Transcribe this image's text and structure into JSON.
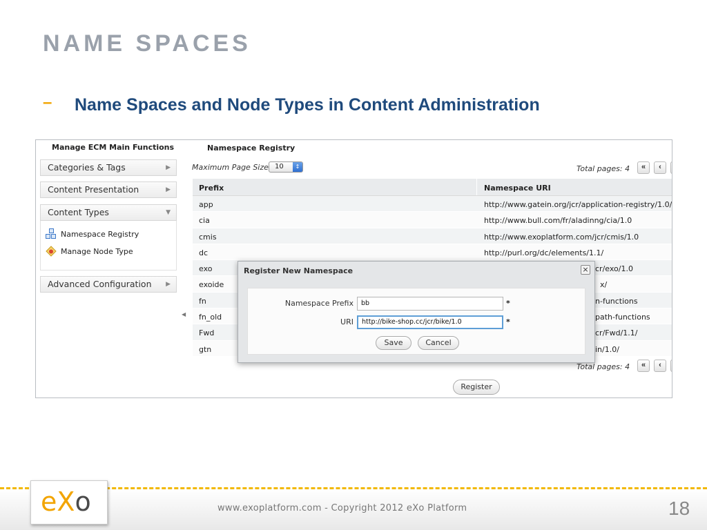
{
  "slide": {
    "title": "NAME SPACES",
    "bullet_dash": "–",
    "bullet": "Name Spaces and Node Types in Content Administration"
  },
  "left_panel": {
    "header": "Manage ECM Main Functions",
    "items": [
      {
        "label": "Categories & Tags",
        "icon": "chevron-right-icon"
      },
      {
        "label": "Content Presentation",
        "icon": "chevron-right-icon"
      },
      {
        "label": "Content Types",
        "icon": "chevron-down-icon"
      },
      {
        "label": "Advanced Configuration",
        "icon": "chevron-right-icon"
      }
    ],
    "sub_items": [
      {
        "label": "Namespace Registry",
        "icon": "namespace-registry-icon"
      },
      {
        "label": "Manage Node Type",
        "icon": "node-type-icon"
      }
    ]
  },
  "registry": {
    "title": "Namespace Registry",
    "page_size_label": "Maximum Page Size:",
    "page_size_value": "10",
    "total_pages_label": "Total pages:",
    "total_pages_value": "4",
    "first_page": "«",
    "prev_page": "‹",
    "columns": [
      "Prefix",
      "Namespace URI"
    ],
    "rows": [
      {
        "prefix": "app",
        "uri": "http://www.gatein.org/jcr/application-registry/1.0/"
      },
      {
        "prefix": "cia",
        "uri": "http://www.bull.com/fr/aladinng/cia/1.0"
      },
      {
        "prefix": "cmis",
        "uri": "http://www.exoplatform.com/jcr/cmis/1.0"
      },
      {
        "prefix": "dc",
        "uri": "http://purl.org/dc/elements/1.1/"
      },
      {
        "prefix": "exo",
        "uri": "cr/exo/1.0"
      },
      {
        "prefix": "exoide",
        "uri": "x/"
      },
      {
        "prefix": "fn",
        "uri": "n-functions"
      },
      {
        "prefix": "fn_old",
        "uri": "path-functions"
      },
      {
        "prefix": "Fwd",
        "uri": "cr/Fwd/1.1/"
      },
      {
        "prefix": "gtn",
        "uri": "in/1.0/"
      }
    ],
    "register_button": "Register"
  },
  "modal": {
    "title": "Register New Namespace",
    "close": "×",
    "prefix_label": "Namespace Prefix",
    "prefix_value": "bb",
    "uri_label": "URI",
    "uri_value": "http://bike-shop.cc/jcr/bike/1.0",
    "required_mark": "*",
    "save": "Save",
    "cancel": "Cancel"
  },
  "footer": {
    "logo": {
      "e": "e",
      "x": "X",
      "o": "o"
    },
    "copyright": "www.exoplatform.com - Copyright 2012 eXo Platform",
    "page_number": "18"
  },
  "colors": {
    "title_gray": "#9aa1ab",
    "bullet_blue": "#1f4a7c",
    "accent_orange": "#f2a400"
  }
}
